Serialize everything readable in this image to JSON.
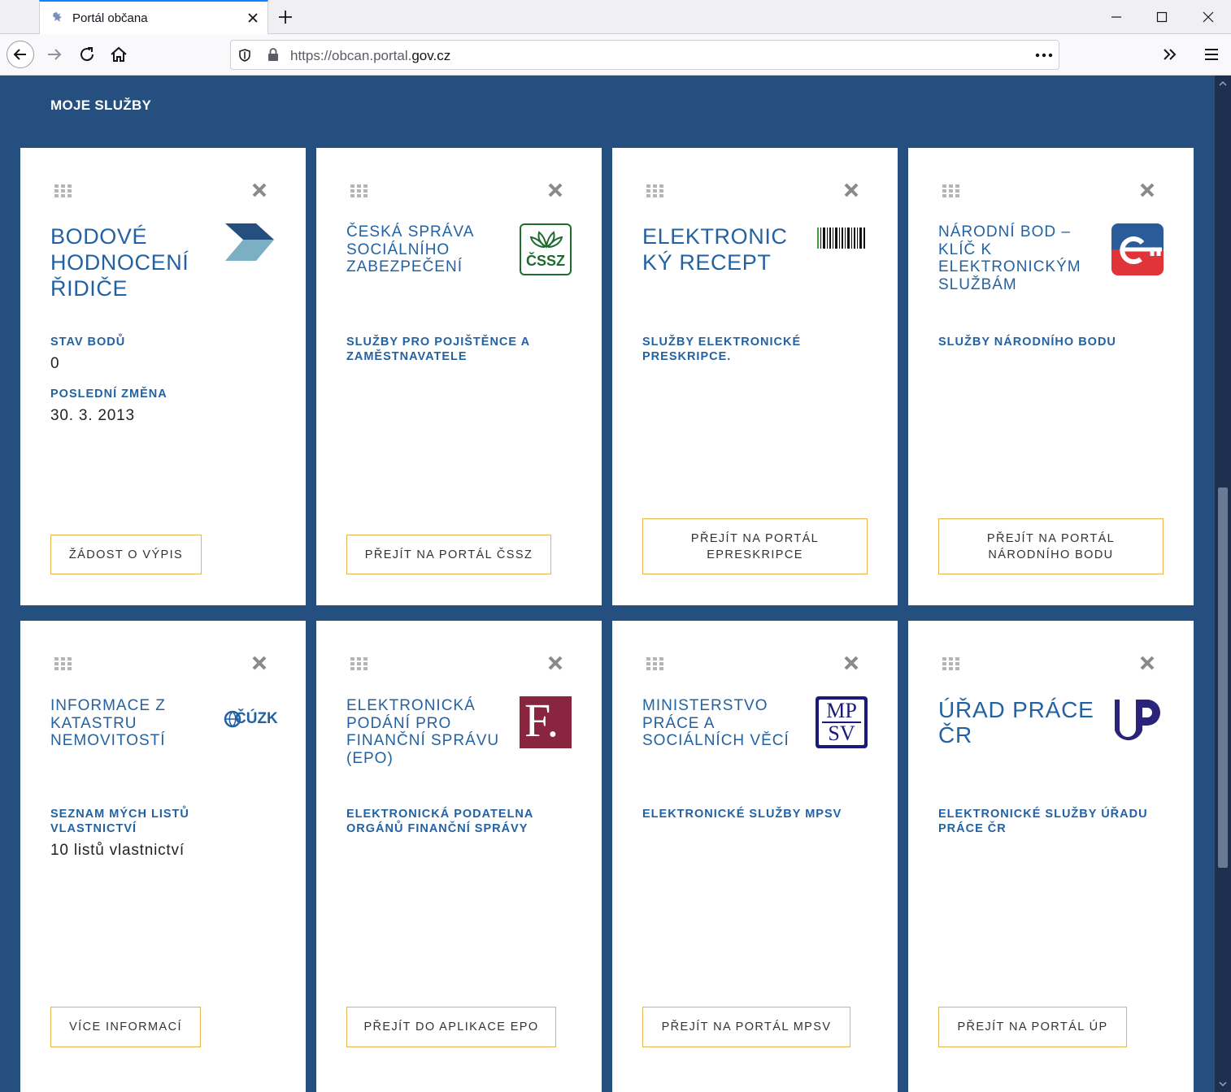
{
  "browser": {
    "tab_title": "Portál občana",
    "url_host_prefix": "https://obcan.portal.",
    "url_host_domain": "gov.cz"
  },
  "section": {
    "title": "MOJE SLUŽBY"
  },
  "cards": [
    {
      "title": "BODOVÉ HODNOCENÍ ŘIDIČE",
      "subtitle": "STAV BODŮ",
      "value": "0",
      "subtitle2": "POSLEDNÍ ZMĚNA",
      "value2": "30. 3. 2013",
      "button": "ŽÁDOST O VÝPIS"
    },
    {
      "title": "ČESKÁ SPRÁVA SOCIÁLNÍHO ZABEZPEČENÍ",
      "subtitle": "SLUŽBY PRO POJIŠTĚNCE A ZAMĚSTNAVATELE",
      "logo_text": "ČSSZ",
      "button": "PŘEJÍT NA PORTÁL ČSSZ"
    },
    {
      "title": "ELEKTRONICKÝ RECEPT",
      "subtitle": "SLUŽBY ELEKTRONICKÉ PRESKRIPCE.",
      "button": "PŘEJÍT NA PORTÁL EPRESKRIPCE"
    },
    {
      "title": "NÁRODNÍ BOD – KLÍČ K ELEKTRONICKÝM SLUŽBÁM",
      "subtitle": "SLUŽBY NÁRODNÍHO BODU",
      "button": "PŘEJÍT NA PORTÁL NÁRODNÍHO BODU"
    },
    {
      "title": "INFORMACE Z KATASTRU NEMOVITOSTÍ",
      "subtitle": "SEZNAM MÝCH LISTŮ VLASTNICTVÍ",
      "value": "10 listů vlastnictví",
      "logo_text": "ČÚZK",
      "button": "VÍCE INFORMACÍ"
    },
    {
      "title": "ELEKTRONICKÁ PODÁNÍ PRO FINANČNÍ SPRÁVU (EPO)",
      "subtitle": "ELEKTRONICKÁ PODATELNA ORGÁNŮ FINANČNÍ SPRÁVY",
      "logo_text": "F.",
      "button": "PŘEJÍT DO APLIKACE EPO"
    },
    {
      "title": "MINISTERSTVO PRÁCE A SOCIÁLNÍCH VĚCÍ",
      "subtitle": "ELEKTRONICKÉ SLUŽBY MPSV",
      "logo_line1": "MP",
      "logo_line2": "SV",
      "button": "PŘEJÍT NA PORTÁL MPSV"
    },
    {
      "title": "ÚŘAD PRÁCE ČR",
      "subtitle": "ELEKTRONICKÉ SLUŽBY ÚŘADU PRÁCE ČR",
      "button": "PŘEJÍT NA PORTÁL ÚP"
    }
  ],
  "colors": {
    "page_bg": "#244f7e",
    "title_blue": "#2362a2",
    "button_border": "#e6b24b",
    "cssz_green": "#1e6b30",
    "epo_red": "#8a2540",
    "mpsv_navy": "#1a1a7a",
    "up_purple": "#2a237a",
    "nb_red": "#e0333a",
    "nb_blue": "#2b5c9a"
  }
}
